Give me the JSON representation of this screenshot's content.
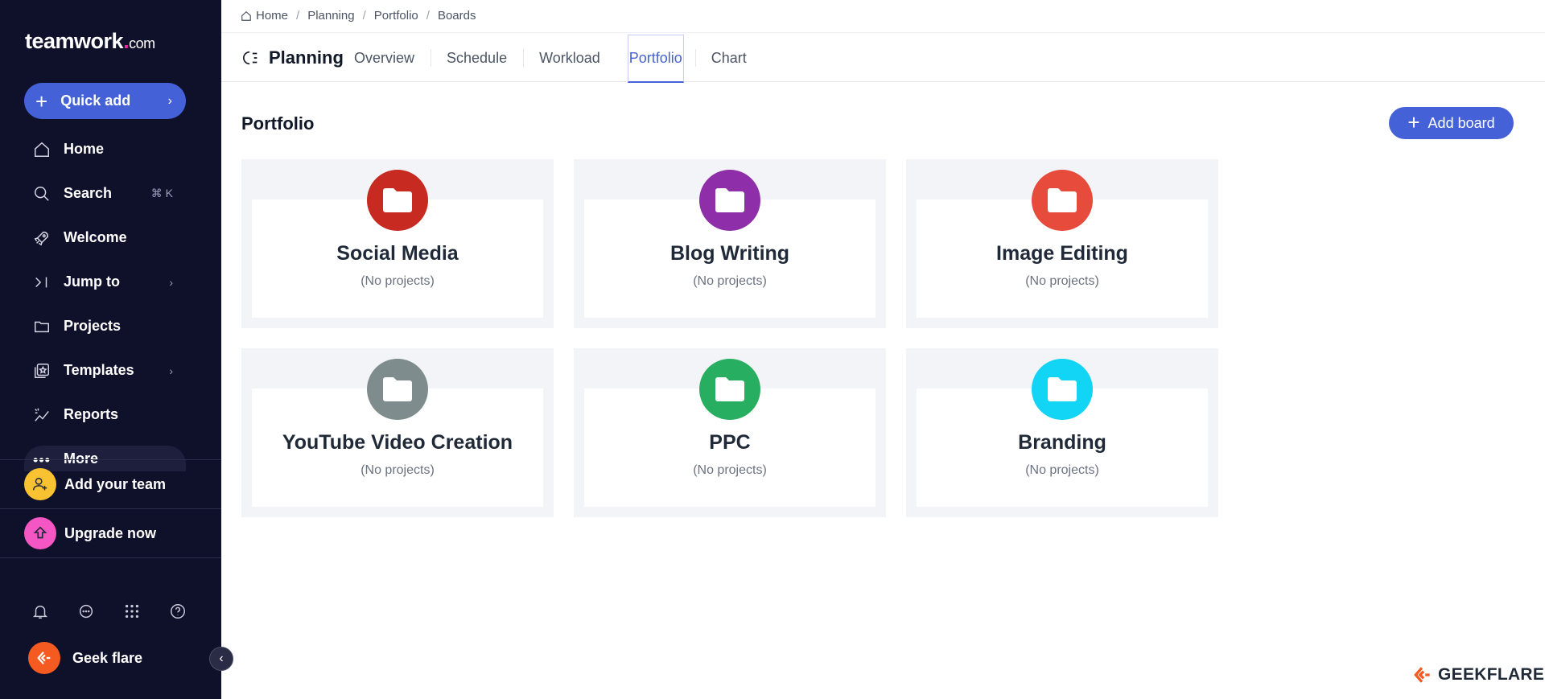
{
  "brand": {
    "name": "teamwork",
    "dot": ".",
    "suffix": "com"
  },
  "sidebar": {
    "quick_add": "Quick add",
    "items": [
      {
        "label": "Home",
        "icon": "home-icon"
      },
      {
        "label": "Search",
        "icon": "search-icon",
        "shortcut": "⌘ K"
      },
      {
        "label": "Welcome",
        "icon": "rocket-icon"
      },
      {
        "label": "Jump to",
        "icon": "jump-icon"
      },
      {
        "label": "Projects",
        "icon": "folder-icon"
      },
      {
        "label": "Templates",
        "icon": "templates-icon"
      },
      {
        "label": "Reports",
        "icon": "reports-icon"
      },
      {
        "label": "More",
        "icon": "more-icon"
      }
    ],
    "add_team": "Add your team",
    "upgrade": "Upgrade now",
    "user_name": "Geek flare",
    "colors": {
      "bg": "#0f1029",
      "accent": "#4461d7",
      "team": "#f9c233",
      "upgrade": "#f456c4",
      "avatar": "#f55b21"
    }
  },
  "breadcrumb": [
    "Home",
    "Planning",
    "Portfolio",
    "Boards"
  ],
  "header": {
    "title": "Planning",
    "tabs": [
      "Overview",
      "Schedule",
      "Workload",
      "Portfolio",
      "Chart"
    ],
    "active_tab": "Portfolio"
  },
  "main": {
    "section_title": "Portfolio",
    "add_board": "Add board",
    "boards": [
      {
        "name": "Social Media",
        "sub": "(No projects)",
        "color": "#c62a21"
      },
      {
        "name": "Blog Writing",
        "sub": "(No projects)",
        "color": "#8e2ea8"
      },
      {
        "name": "Image Editing",
        "sub": "(No projects)",
        "color": "#e74b3c"
      },
      {
        "name": "YouTube Video Creation",
        "sub": "(No projects)",
        "color": "#7f8c8d"
      },
      {
        "name": "PPC",
        "sub": "(No projects)",
        "color": "#27ae60"
      },
      {
        "name": "Branding",
        "sub": "(No projects)",
        "color": "#12d4f5"
      }
    ]
  },
  "watermark": "GEEKFLARE"
}
